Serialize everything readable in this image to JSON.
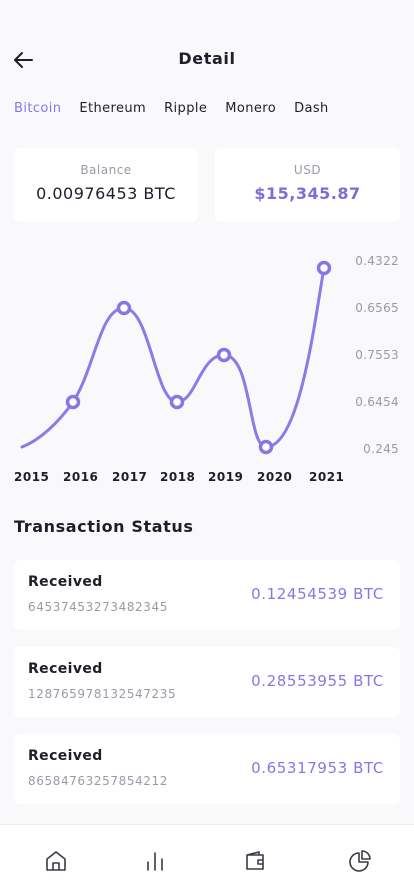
{
  "header": {
    "title": "Detail",
    "back_icon": "arrow-left-icon"
  },
  "tabs": [
    {
      "label": "Bitcoin",
      "active": true
    },
    {
      "label": "Ethereum",
      "active": false
    },
    {
      "label": "Ripple",
      "active": false
    },
    {
      "label": "Monero",
      "active": false
    },
    {
      "label": "Dash",
      "active": false
    }
  ],
  "balance": {
    "label": "Balance",
    "value": "0.00976453 BTC"
  },
  "usd": {
    "label": "USD",
    "value": "$15,345.87"
  },
  "colors": {
    "accent": "#8a76e3",
    "usd_text": "#7b6fd6",
    "muted": "#9a9aa6"
  },
  "chart_data": {
    "type": "line",
    "x": [
      "2015",
      "2016",
      "2017",
      "2018",
      "2019",
      "2020",
      "2021"
    ],
    "y_tick_labels": [
      "0.4322",
      "0.6565",
      "0.7553",
      "0.6454",
      "0.245"
    ],
    "markers_at": [
      "2016",
      "2017",
      "2018",
      "2019",
      "2020",
      "2021"
    ],
    "series": [
      {
        "values": [
          0.245,
          0.6454,
          0.6565,
          0.6454,
          0.7553,
          0.245,
          0.4322
        ]
      }
    ],
    "grid": false
  },
  "transactions": {
    "title": "Transaction Status",
    "items": [
      {
        "label": "Received",
        "id": "64537453273482345",
        "amount": "0.12454539 BTC"
      },
      {
        "label": "Received",
        "id": "128765978132547235",
        "amount": "0.28553955 BTC"
      },
      {
        "label": "Received",
        "id": "86584763257854212",
        "amount": "0.65317953 BTC"
      }
    ]
  },
  "nav": {
    "icons": [
      "home-icon",
      "bar-chart-icon",
      "wallet-icon",
      "pie-chart-icon"
    ]
  }
}
